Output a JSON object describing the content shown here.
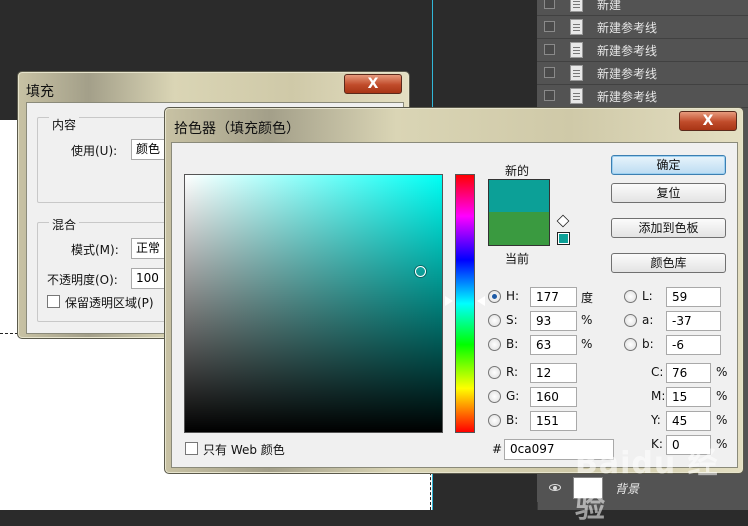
{
  "layers": {
    "rows": [
      "新建",
      "新建参考线",
      "新建参考线",
      "新建参考线",
      "新建参考线"
    ],
    "bottom_layer_name": "背景"
  },
  "fill_dialog": {
    "title": "填充",
    "close_label": "X",
    "contents_group": "内容",
    "use_label": "使用(U):",
    "use_value": "颜色",
    "blending_group": "混合",
    "mode_label": "模式(M):",
    "mode_value": "正常",
    "opacity_label": "不透明度(O):",
    "opacity_value": "100",
    "preserve_label": "保留透明区域(P)"
  },
  "color_picker": {
    "title": "拾色器（填充颜色）",
    "close_label": "X",
    "new_label": "新的",
    "current_label": "当前",
    "new_color": "#0ca097",
    "current_color": "#3a9a40",
    "ok_label": "确定",
    "reset_label": "复位",
    "add_swatch_label": "添加到色板",
    "color_library_label": "颜色库",
    "web_only_label": "只有 Web 颜色",
    "hex_label": "#",
    "hex_value": "0ca097",
    "hsb": [
      {
        "label": "H:",
        "value": "177",
        "unit": "度",
        "selected": true
      },
      {
        "label": "S:",
        "value": "93",
        "unit": "%",
        "selected": false
      },
      {
        "label": "B:",
        "value": "63",
        "unit": "%",
        "selected": false
      }
    ],
    "rgb": [
      {
        "label": "R:",
        "value": "12"
      },
      {
        "label": "G:",
        "value": "160"
      },
      {
        "label": "B:",
        "value": "151"
      }
    ],
    "lab": [
      {
        "label": "L:",
        "value": "59"
      },
      {
        "label": "a:",
        "value": "-37"
      },
      {
        "label": "b:",
        "value": "-6"
      }
    ],
    "cmyk": [
      {
        "label": "C:",
        "value": "76",
        "unit": "%"
      },
      {
        "label": "M:",
        "value": "15",
        "unit": "%"
      },
      {
        "label": "Y:",
        "value": "45",
        "unit": "%"
      },
      {
        "label": "K:",
        "value": "0",
        "unit": "%"
      }
    ],
    "hue_level": 0.49
  },
  "watermark": "Baidu 经验"
}
